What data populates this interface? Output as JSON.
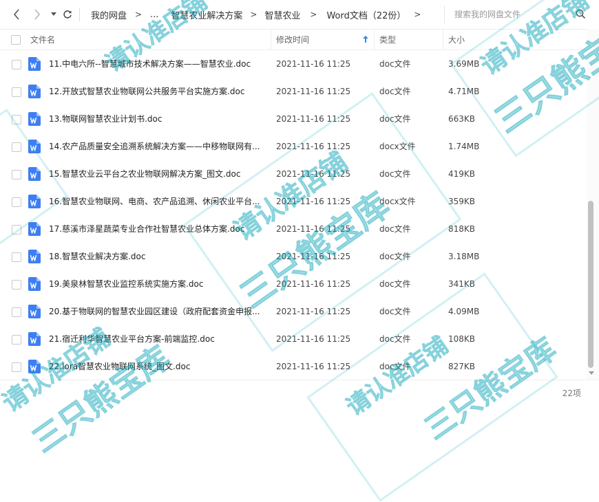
{
  "nav": {
    "breadcrumbs": [
      "我的网盘",
      "...",
      "智慧农业解决方案",
      "智慧农业",
      "Word文档（22份）"
    ],
    "search_placeholder": "搜索我的网盘文件"
  },
  "columns": {
    "name": "文件名",
    "modified": "修改时间",
    "type": "类型",
    "size": "大小"
  },
  "files": [
    {
      "name": "11.中电六所--智慧城市技术解决方案——智慧农业.doc",
      "date": "2021-11-16 11:25",
      "type": "doc文件",
      "size": "3.69MB"
    },
    {
      "name": "12.开放式智慧农业物联网公共服务平台实施方案.doc",
      "date": "2021-11-16 11:25",
      "type": "doc文件",
      "size": "4.71MB"
    },
    {
      "name": "13.物联网智慧农业计划书.doc",
      "date": "2021-11-16 11:25",
      "type": "doc文件",
      "size": "663KB"
    },
    {
      "name": "14.农产品质量安全追溯系统解决方案——中移物联网有...",
      "date": "2021-11-16 11:25",
      "type": "docx文件",
      "size": "1.74MB"
    },
    {
      "name": "15.智慧农业云平台之农业物联网解决方案_图文.doc",
      "date": "2021-11-16 11:25",
      "type": "doc文件",
      "size": "419KB"
    },
    {
      "name": "16.智慧农业物联网、电商、农产品追溯、休闲农业平台...",
      "date": "2021-11-16 11:25",
      "type": "docx文件",
      "size": "359KB"
    },
    {
      "name": "17.慈溪市泽星蔬菜专业合作社智慧农业总体方案.doc",
      "date": "2021-11-16 11:25",
      "type": "doc文件",
      "size": "818KB"
    },
    {
      "name": "18.智慧农业解决方案.doc",
      "date": "2021-11-16 11:25",
      "type": "doc文件",
      "size": "3.18MB"
    },
    {
      "name": "19.美泉林智慧农业监控系统实施方案.doc",
      "date": "2021-11-16 11:25",
      "type": "doc文件",
      "size": "341KB"
    },
    {
      "name": "20.基于物联网的智慧农业园区建设（政府配套资金申报...",
      "date": "2021-11-16 11:25",
      "type": "doc文件",
      "size": "4.09MB"
    },
    {
      "name": "21.宿迁利华智慧农业平台方案-前端监控.doc",
      "date": "2021-11-16 11:25",
      "type": "doc文件",
      "size": "108KB"
    },
    {
      "name": "22.lora智慧农业物联网系统_图文.doc",
      "date": "2021-11-16 11:25",
      "type": "doc文件",
      "size": "827KB"
    }
  ],
  "status": {
    "count": "22项"
  },
  "watermark": {
    "line1": "请认准店铺",
    "line2": "三只熊宝库"
  },
  "colors": {
    "word_icon": "#3d7ef3",
    "watermark": "#00aabe",
    "scroll_thumb": "#c1c1c1"
  }
}
